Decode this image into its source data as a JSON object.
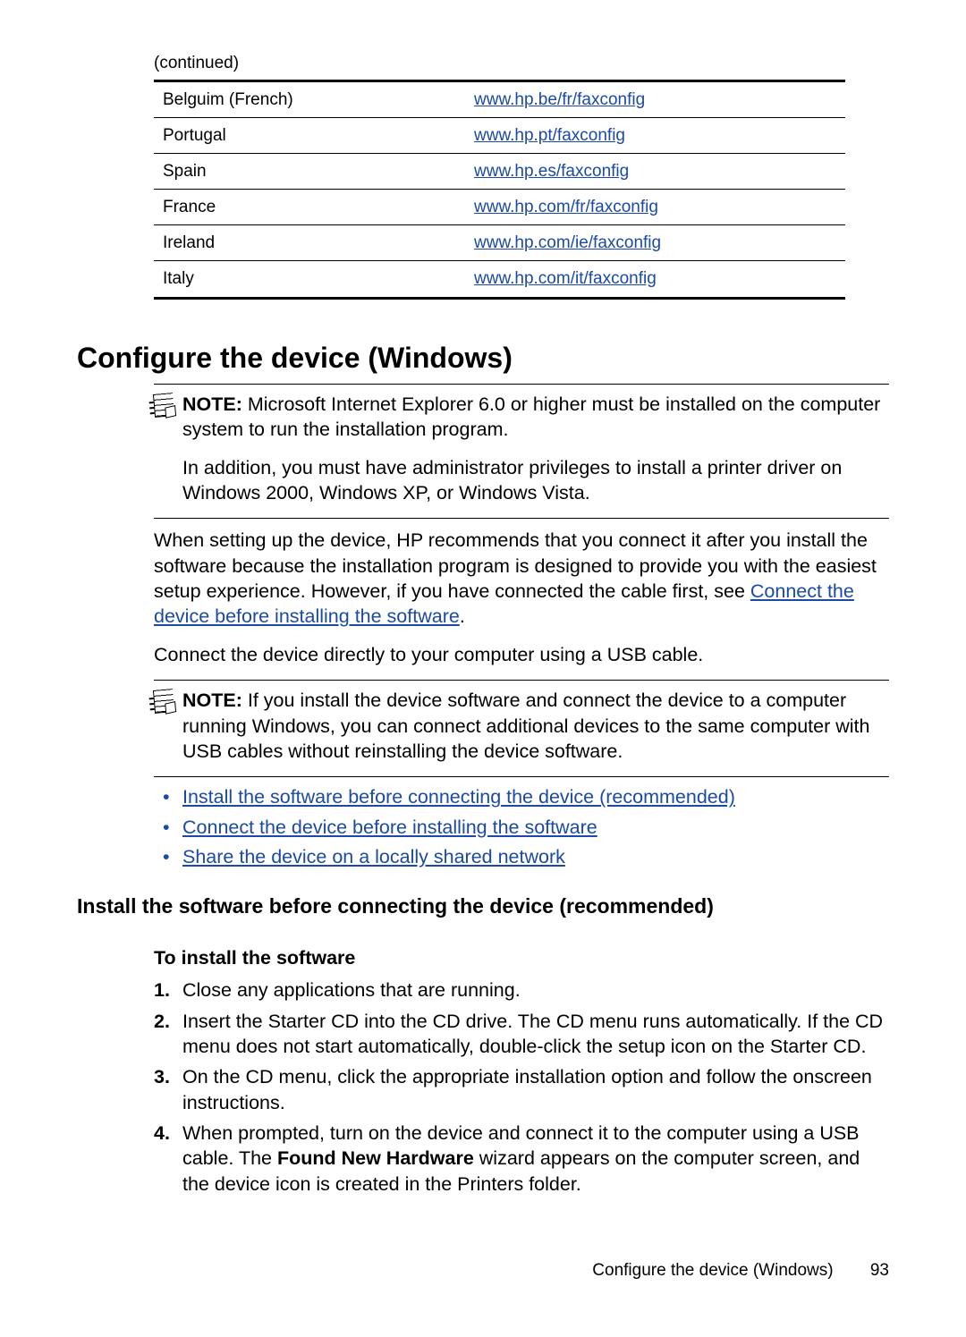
{
  "continued_label": "(continued)",
  "table": {
    "rows": [
      {
        "country": "Belguim (French)",
        "url": "www.hp.be/fr/faxconfig"
      },
      {
        "country": "Portugal",
        "url": "www.hp.pt/faxconfig"
      },
      {
        "country": "Spain",
        "url": "www.hp.es/faxconfig"
      },
      {
        "country": "France",
        "url": "www.hp.com/fr/faxconfig"
      },
      {
        "country": "Ireland",
        "url": "www.hp.com/ie/faxconfig"
      },
      {
        "country": "Italy",
        "url": "www.hp.com/it/faxconfig"
      }
    ]
  },
  "h1": "Configure the device (Windows)",
  "note1": {
    "label": "NOTE:",
    "p1": "Microsoft Internet Explorer 6.0 or higher must be installed on the computer system to run the installation program.",
    "p2": "In addition, you must have administrator privileges to install a printer driver on Windows 2000, Windows XP, or Windows Vista."
  },
  "body": {
    "p1_a": "When setting up the device, HP recommends that you connect it after you install the software because the installation program is designed to provide you with the easiest setup experience. However, if you have connected the cable first, see ",
    "p1_link": "Connect the device before installing the software",
    "p1_b": ".",
    "p2": "Connect the device directly to your computer using a USB cable."
  },
  "note2": {
    "label": "NOTE:",
    "p1": "If you install the device software and connect the device to a computer running Windows, you can connect additional devices to the same computer with USB cables without reinstalling the device software."
  },
  "links": [
    "Install the software before connecting the device (recommended)",
    "Connect the device before installing the software",
    "Share the device on a locally shared network"
  ],
  "h2": "Install the software before connecting the device (recommended)",
  "h3": "To install the software",
  "steps": [
    "Close any applications that are running.",
    "Insert the Starter CD into the CD drive. The CD menu runs automatically. If the CD menu does not start automatically, double-click the setup icon on the Starter CD.",
    "On the CD menu, click the appropriate installation option and follow the onscreen instructions."
  ],
  "step4": {
    "a": "When prompted, turn on the device and connect it to the computer using a USB cable. The ",
    "bold": "Found New Hardware",
    "b": " wizard appears on the computer screen, and the device icon is created in the Printers folder."
  },
  "footer": {
    "section": "Configure the device (Windows)",
    "page": "93"
  }
}
